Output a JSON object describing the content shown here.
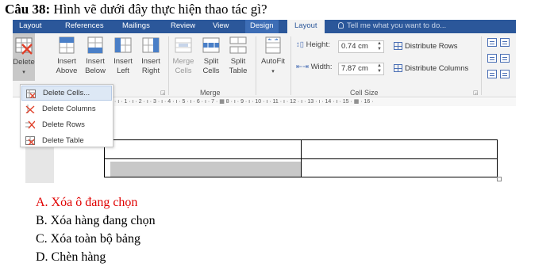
{
  "question": {
    "number": "Câu 38:",
    "text": "Hình vẽ dưới đây thực hiện thao tác gì?"
  },
  "tabs": [
    "Layout",
    "References",
    "Mailings",
    "Review",
    "View",
    "Design",
    "Layout"
  ],
  "tell_me": "Tell me what you want to do...",
  "ribbon": {
    "delete": {
      "label": "Delete",
      "arrow": "▾"
    },
    "insert_above": {
      "line1": "Insert",
      "line2": "Above"
    },
    "insert_below": {
      "line1": "Insert",
      "line2": "Below"
    },
    "insert_left": {
      "line1": "Insert",
      "line2": "Left"
    },
    "insert_right": {
      "line1": "Insert",
      "line2": "Right"
    },
    "merge_cells": {
      "line1": "Merge",
      "line2": "Cells"
    },
    "split_cells": {
      "line1": "Split",
      "line2": "Cells"
    },
    "split_table": {
      "line1": "Split",
      "line2": "Table"
    },
    "autofit": {
      "label": "AutoFit",
      "arrow": "▾"
    },
    "merge_group_label": "Merge",
    "height_label": "Height:",
    "height_value": "0.74 cm",
    "width_label": "Width:",
    "width_value": "7.87 cm",
    "distribute_rows": "Distribute Rows",
    "distribute_columns": "Distribute Columns",
    "cell_size_label": "Cell Size"
  },
  "ruler_text": "· ı · 1 · ı · 2 · ı · 3 · ı · 4 · ı · 5 · ı · 6 · ı · 7 ·  ▦  8 · ı · 9 · ı · 10 · ı · 11 · ı · 12 · ı · 13 · ı · 14 · ı · 15 · ▦ · 16 ·",
  "menu": [
    {
      "label": "Delete Cells...",
      "icon": "delete-cells-icon"
    },
    {
      "label": "Delete Columns",
      "icon": "delete-columns-icon"
    },
    {
      "label": "Delete Rows",
      "icon": "delete-rows-icon"
    },
    {
      "label": "Delete Table",
      "icon": "delete-table-icon"
    }
  ],
  "answers": [
    {
      "text": "A. Xóa ô đang chọn",
      "correct": true
    },
    {
      "text": "B. Xóa hàng đang chọn",
      "correct": false
    },
    {
      "text": "C. Xóa toàn bộ bảng",
      "correct": false
    },
    {
      "text": "D. Chèn hàng",
      "correct": false
    }
  ],
  "colors": {
    "tab_bar": "#2b579a",
    "ribbon": "#f3f3f3",
    "correct_answer": "#e00000",
    "menu_hover": "#dde8f5"
  }
}
